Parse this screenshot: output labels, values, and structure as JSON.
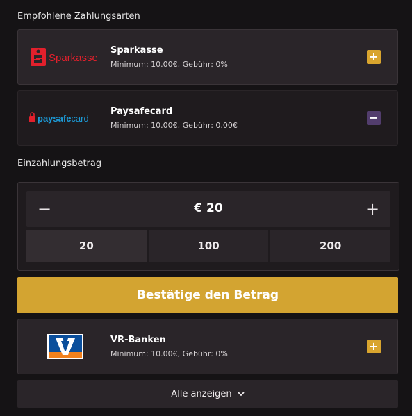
{
  "sections": {
    "recommended_title": "Empfohlene Zahlungsarten",
    "amount_title": "Einzahlungsbetrag"
  },
  "methods": [
    {
      "name": "Sparkasse",
      "meta": "Minimum: 10.00€, Gebühr: 0%",
      "logo_text": "Sparkasse",
      "toggle": "+"
    },
    {
      "name": "Paysafecard",
      "meta": "Minimum: 10.00€, Gebühr: 0.00€",
      "logo_text_a": "paysafe",
      "logo_text_b": "card",
      "toggle": "−"
    },
    {
      "name": "VR-Banken",
      "meta": "Minimum: 10.00€, Gebühr: 0%",
      "toggle": "+"
    }
  ],
  "amount": {
    "minus": "−",
    "plus": "+",
    "value": "€ 20",
    "presets": [
      "20",
      "100",
      "200"
    ]
  },
  "confirm_label": "Bestätige den Betrag",
  "show_all_label": "Alle anzeigen",
  "colors": {
    "accent": "#d3a431",
    "selected_toggle": "#523d6d",
    "sparkasse_red": "#e2202c",
    "paysafe_blue": "#1c9bd8"
  }
}
